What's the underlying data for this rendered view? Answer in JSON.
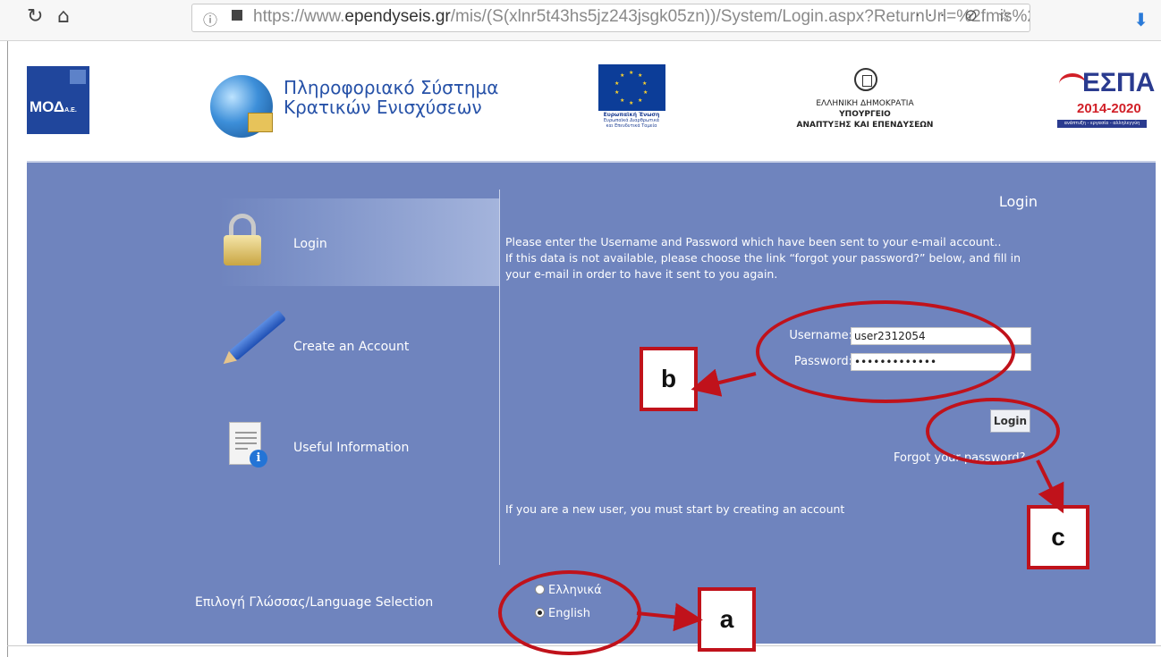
{
  "browser": {
    "url_prefix": "https://www.",
    "url_domain": "ependyseis.gr",
    "url_path": "/mis/(S(xlnr5t43hs5jz243jsgk05zn))/System/Login.aspx?ReturnUrl=%2fmis%2f",
    "more_label": "···"
  },
  "header": {
    "mod_label": "ΜΟΔ",
    "mod_suffix": "Α.Ε.",
    "system_title_line1": "Πληροφοριακό Σύστημα",
    "system_title_line2": "Κρατικών Ενισχύσεων",
    "eu_name": "Ευρωπαϊκή Ένωση",
    "eu_fund1": "Ευρωπαϊκά Διαρθρωτικά",
    "eu_fund2": "και Επενδυτικά Ταμεία",
    "gr_line1": "ΕΛΛΗΝΙΚΗ ΔΗΜΟΚΡΑΤΙΑ",
    "gr_line2": "ΥΠΟΥΡΓΕΙΟ",
    "gr_line3": "ΑΝΑΠΤΥΞΗΣ ΚΑΙ ΕΠΕΝΔΥΣΕΩΝ",
    "espa_title": "ΕΣΠΑ",
    "espa_years": "2014-2020",
    "espa_slogan": "ανάπτυξη - εργασία - αλληλεγγύη"
  },
  "sidebar": {
    "items": [
      {
        "label": "Login",
        "icon": "padlock-icon"
      },
      {
        "label": "Create an Account",
        "icon": "pencil-icon"
      },
      {
        "label": "Useful Information",
        "icon": "document-info-icon"
      }
    ]
  },
  "login": {
    "heading": "Login",
    "instructions_1": "Please enter the Username and Password which have been sent to your e-mail account..",
    "instructions_2": "If this data is not available, please choose the link “forgot your password?” below, and fill in your e-mail in order to have it sent to you again.",
    "username_label": "Username:",
    "username_value": "user2312054",
    "password_label": "Password:",
    "password_value": "•••••••••••••",
    "login_button": "Login",
    "forgot_link": "Forgot your password?",
    "new_user_text": "If you are a new user, you must start by creating an account"
  },
  "language": {
    "label": "Επιλογή Γλώσσας/Language Selection",
    "options": [
      "Ελληνικά",
      "English"
    ],
    "selected": "English"
  },
  "annotations": {
    "a": "a",
    "b": "b",
    "c": "c",
    "color": "#c0121b"
  },
  "colors": {
    "panel": "#6f84be",
    "brand_blue": "#2752a8"
  }
}
